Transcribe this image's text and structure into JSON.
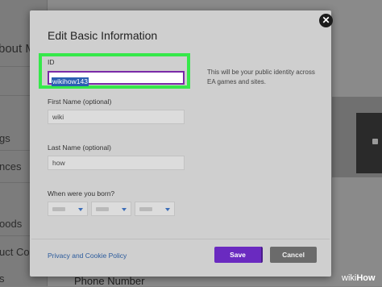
{
  "background": {
    "partial_texts": [
      "bout M",
      "gs",
      "nces",
      "oods",
      "uct Co",
      "s"
    ],
    "bottom_text": "Phone Number"
  },
  "modal": {
    "title": "Edit Basic Information",
    "close_icon": "close-icon",
    "id_field": {
      "label": "ID",
      "value": "wikihow143",
      "hint": "This will be your public identity across EA games and sites."
    },
    "first_name": {
      "label": "First Name (optional)",
      "value": "wiki"
    },
    "last_name": {
      "label": "Last Name (optional)",
      "value": "how"
    },
    "birthday": {
      "label": "When were you born?",
      "selects": [
        "month",
        "day",
        "year"
      ]
    },
    "privacy_link": "Privacy and Cookie Policy",
    "save_label": "Save",
    "cancel_label": "Cancel"
  },
  "colors": {
    "highlight": "#36e84a",
    "save": "#6a2ac0",
    "link": "#2a5a9c",
    "chevron": "#3d6eb8"
  },
  "watermark": {
    "brand_light": "wiki",
    "brand_bold": "How"
  }
}
